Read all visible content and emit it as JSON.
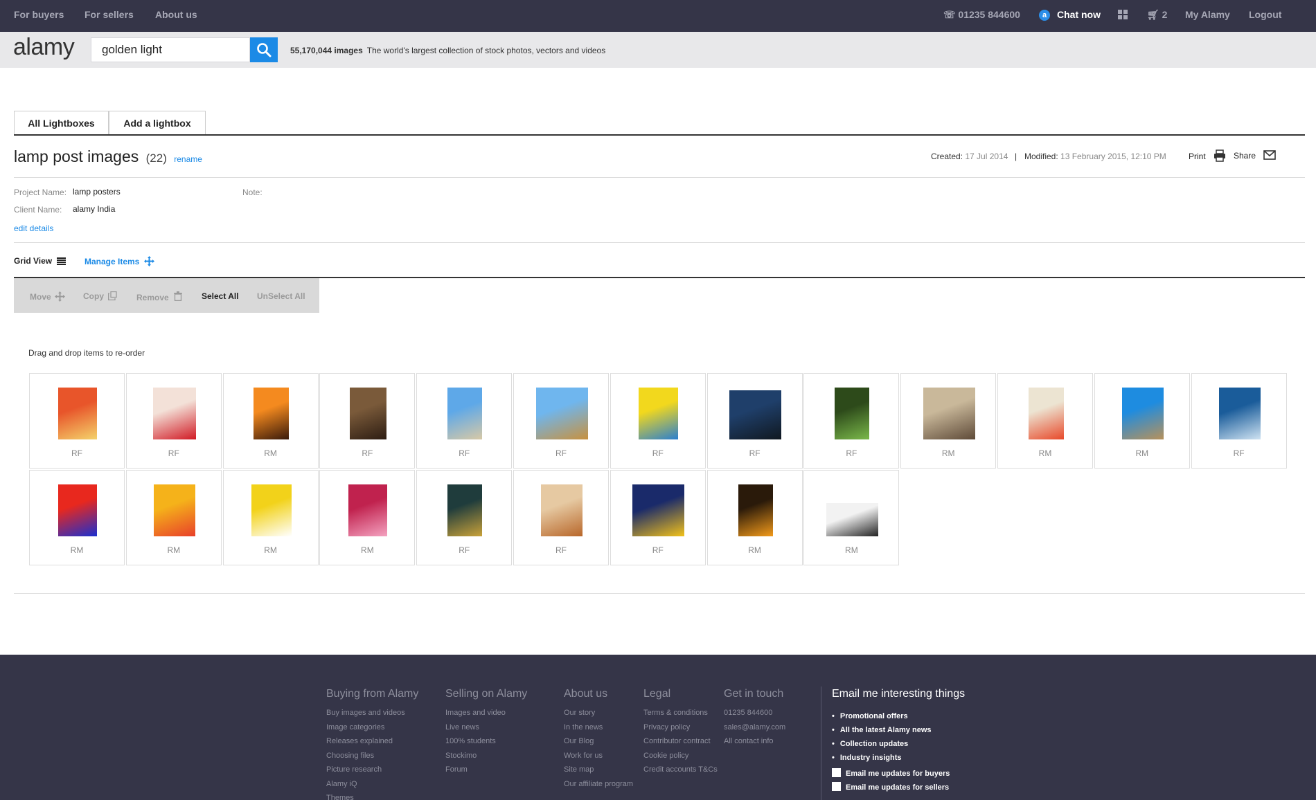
{
  "topnav": {
    "for_buyers": "For buyers",
    "for_sellers": "For sellers",
    "about_us": "About us",
    "phone": "01235 844600",
    "chat_icon_letter": "a",
    "chat": "Chat now",
    "cart_count": "2",
    "my_alamy": "My Alamy",
    "logout": "Logout"
  },
  "search": {
    "logo": "alamy",
    "query": "golden light",
    "image_count": "55,170,044 images",
    "tagline": "The world's largest collection of stock photos, vectors and videos"
  },
  "tabs": {
    "all": "All Lightboxes",
    "add": "Add a lightbox"
  },
  "lightbox": {
    "title": "lamp post images",
    "count": "(22)",
    "rename": "rename",
    "created_label": "Created:",
    "created": "17 Jul 2014",
    "separator": "|",
    "modified_label": "Modified:",
    "modified": "13 February 2015, 12:10 PM",
    "print": "Print",
    "share": "Share"
  },
  "details": {
    "project_label": "Project Name:",
    "project": "lamp posters",
    "client_label": "Client Name:",
    "client": "alamy India",
    "note_label": "Note:",
    "edit": "edit details"
  },
  "view": {
    "grid": "Grid View",
    "manage": "Manage Items"
  },
  "actions": {
    "move": "Move",
    "copy": "Copy",
    "remove": "Remove",
    "select_all": "Select All",
    "unselect_all": "UnSelect All"
  },
  "hint": "Drag and drop items to re-order",
  "items": [
    {
      "license": "RF",
      "colors": [
        "#e8552a",
        "#f4d36b"
      ]
    },
    {
      "license": "RF",
      "colors": [
        "#f3e1d8",
        "#d11a24"
      ]
    },
    {
      "license": "RM",
      "colors": [
        "#f48a1f",
        "#3a1a0a"
      ]
    },
    {
      "license": "RF",
      "colors": [
        "#7a5a3a",
        "#2d1d12"
      ]
    },
    {
      "license": "RF",
      "colors": [
        "#5ea8e8",
        "#d8c9a6"
      ]
    },
    {
      "license": "RF",
      "colors": [
        "#6fb6ee",
        "#c8913e"
      ]
    },
    {
      "license": "RF",
      "colors": [
        "#f2d81d",
        "#2a7fd0"
      ]
    },
    {
      "license": "RF",
      "colors": [
        "#1f3f6a",
        "#101820"
      ]
    },
    {
      "license": "RF",
      "colors": [
        "#2d4a1a",
        "#7ab84a"
      ]
    },
    {
      "license": "RM",
      "colors": [
        "#c9b89a",
        "#5e4a38"
      ]
    },
    {
      "license": "RM",
      "colors": [
        "#ece4d2",
        "#e8492a"
      ]
    },
    {
      "license": "RM",
      "colors": [
        "#1e8ce0",
        "#b8915a"
      ]
    },
    {
      "license": "RF",
      "colors": [
        "#1a5c9a",
        "#cfe3f2"
      ]
    },
    {
      "license": "RM",
      "colors": [
        "#e8281e",
        "#1a2fd0"
      ]
    },
    {
      "license": "RM",
      "colors": [
        "#f5b21a",
        "#e8402a"
      ]
    },
    {
      "license": "RM",
      "colors": [
        "#f2d21a",
        "#ffffff"
      ]
    },
    {
      "license": "RM",
      "colors": [
        "#c0224e",
        "#f4a2c0"
      ]
    },
    {
      "license": "RF",
      "colors": [
        "#1f3c3c",
        "#c9a23a"
      ]
    },
    {
      "license": "RF",
      "colors": [
        "#e6c9a2",
        "#b8672a"
      ]
    },
    {
      "license": "RF",
      "colors": [
        "#1a2a6a",
        "#f2c21a"
      ]
    },
    {
      "license": "RM",
      "colors": [
        "#2a1a0a",
        "#f29a1a"
      ]
    },
    {
      "license": "RM",
      "colors": [
        "#f2f2f2",
        "#222222"
      ]
    }
  ],
  "footer": {
    "columns": [
      {
        "heading": "Buying from Alamy",
        "links": [
          "Buy images and videos",
          "Image categories",
          "Releases explained",
          "Choosing files",
          "Picture research",
          "Alamy iQ",
          "Themes"
        ]
      },
      {
        "heading": "Selling on Alamy",
        "links": [
          "Images and video",
          "Live news",
          "100% students",
          "Stockimo",
          "Forum"
        ]
      },
      {
        "heading": "About us",
        "links": [
          "Our story",
          "In the news",
          "Our Blog",
          "Work for us",
          "Site map",
          "Our affiliate program"
        ]
      },
      {
        "heading": "Legal",
        "links": [
          "Terms & conditions",
          "Privacy policy",
          "Contributor contract",
          "Cookie policy",
          "Credit accounts T&Cs"
        ]
      },
      {
        "heading": "Get in touch",
        "links": [
          "01235 844600",
          "sales@alamy.com",
          "All contact info"
        ]
      }
    ],
    "email_heading": "Email me interesting things",
    "email_items": [
      "Promotional offers",
      "All the latest Alamy news",
      "Collection updates",
      "Industry insights"
    ],
    "buyers_checkbox": "Email me updates for buyers",
    "sellers_checkbox": "Email me updates for sellers"
  }
}
